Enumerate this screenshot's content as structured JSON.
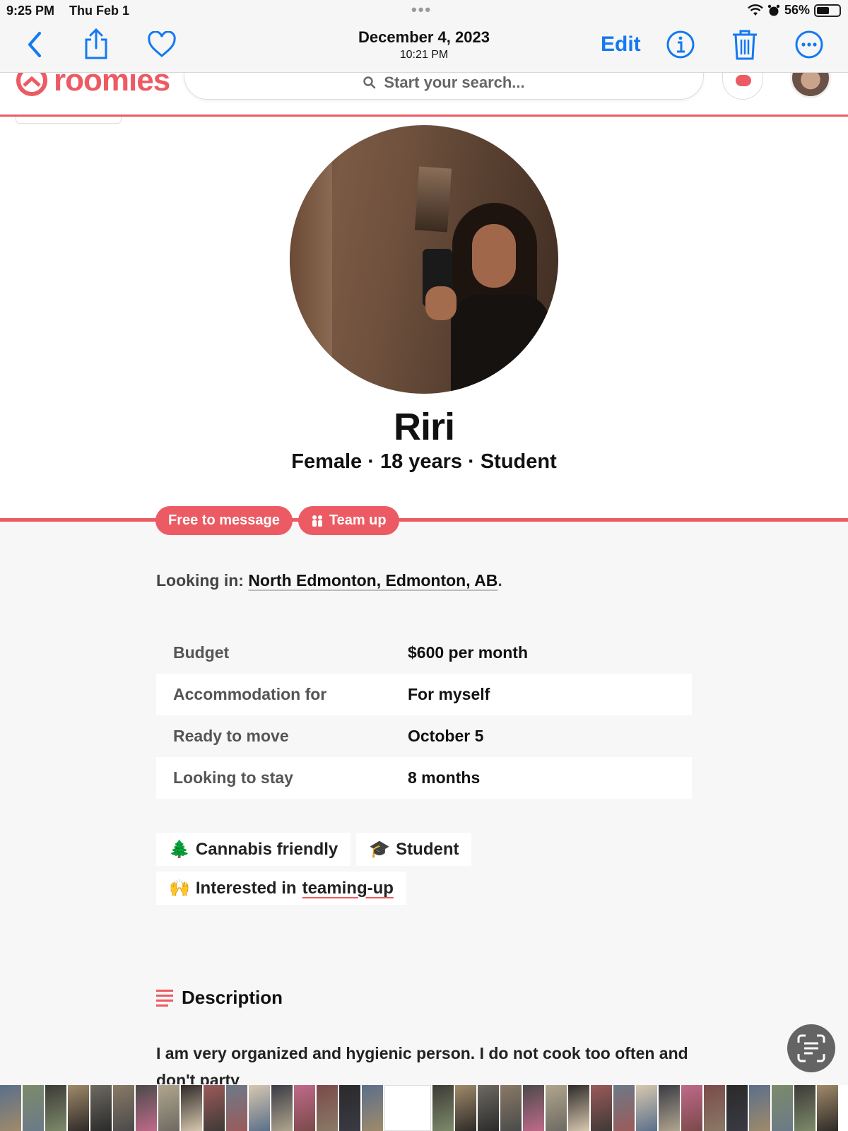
{
  "statusbar": {
    "time": "9:25 PM",
    "date": "Thu Feb 1",
    "battery": "56%",
    "battery_level": 0.56
  },
  "toolbar": {
    "date": "December 4, 2023",
    "time": "10:21 PM",
    "edit_label": "Edit"
  },
  "site": {
    "logo_text": "roomies",
    "search_placeholder": "Start your search..."
  },
  "profile": {
    "name": "Riri",
    "meta": "Female · 18 years · Student",
    "badges": [
      {
        "label": "Free to message"
      },
      {
        "label": "Team up"
      }
    ],
    "looking_label": "Looking in:",
    "looking_location": "North Edmonton, Edmonton, AB",
    "looking_suffix": ".",
    "details": [
      {
        "label": "Budget",
        "value": "$600 per month"
      },
      {
        "label": "Accommodation for",
        "value": "For myself"
      },
      {
        "label": "Ready to move",
        "value": "October 5"
      },
      {
        "label": "Looking to stay",
        "value": "8 months"
      }
    ],
    "tags": {
      "cannabis": {
        "emoji": "🌲",
        "label": "Cannabis friendly"
      },
      "student": {
        "emoji": "🎓",
        "label": "Student"
      },
      "teamup": {
        "emoji": "🙌",
        "prefix": "Interested in",
        "link": "teaming-up"
      }
    },
    "description_title": "Description",
    "description_text": "I am very organized and hygienic person. I do not cook too often and don't party"
  },
  "colors": {
    "brand": "#ec5b63",
    "ios_blue": "#1479f2"
  },
  "icons": [
    "back-icon",
    "share-icon",
    "heart-icon",
    "info-icon",
    "trash-icon",
    "more-icon",
    "search-icon",
    "chat-icon",
    "live-text-icon",
    "wifi-icon",
    "alarm-icon"
  ]
}
